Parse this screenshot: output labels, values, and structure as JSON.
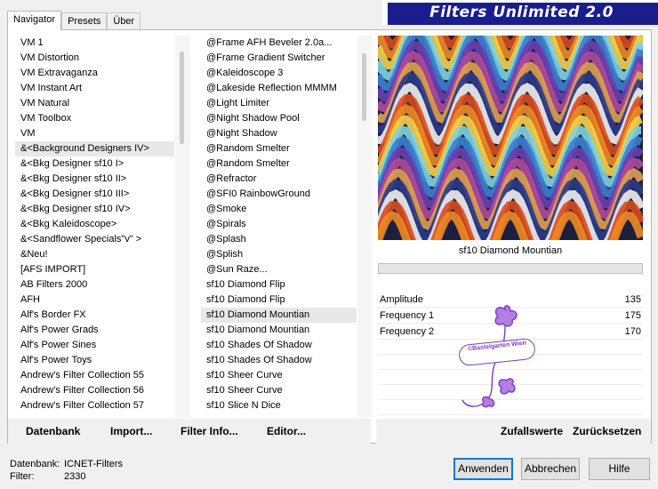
{
  "tabs": [
    "Navigator",
    "Presets",
    "Über"
  ],
  "app_title": "Filters Unlimited 2.0",
  "categories": [
    "VM 1",
    "VM Distortion",
    "VM Extravaganza",
    "VM Instant Art",
    "VM Natural",
    "VM Toolbox",
    "VM",
    "&<Background Designers IV>",
    "&<Bkg Designer sf10 I>",
    "&<Bkg Designer sf10 II>",
    "&<Bkg Designer sf10 III>",
    "&<Bkg Designer sf10 IV>",
    "&<Bkg Kaleidoscope>",
    "&<Sandflower Specials\"v\" >",
    "&Neu!",
    "[AFS IMPORT]",
    "AB Filters 2000",
    "AFH",
    "Alf's Border FX",
    "Alf's Power Grads",
    "Alf's Power Sines",
    "Alf's Power Toys",
    "Andrew's Filter Collection 55",
    "Andrew's Filter Collection 56",
    "Andrew's Filter Collection 57"
  ],
  "filters": [
    "@Frame AFH Beveler 2.0a...",
    "@Frame Gradient Switcher",
    "@Kaleidoscope 3",
    "@Lakeside Reflection MMMM",
    "@Light Limiter",
    "@Night Shadow Pool",
    "@Night Shadow",
    "@Random Smelter",
    "@Random Smelter",
    "@Refractor",
    "@SFI0 RainbowGround",
    "@Smoke",
    "@Spirals",
    "@Splash",
    "@Splish",
    "@Sun Raze...",
    "sf10 Diamond Flip",
    "sf10 Diamond Flip",
    "sf10 Diamond Mountian",
    "sf10 Diamond Mountian",
    "sf10 Shades Of Shadow",
    "sf10 Shades Of Shadow",
    "sf10 Sheer Curve",
    "sf10 Sheer Curve",
    "sf10 Slice N Dice"
  ],
  "selected_filter": "sf10 Diamond Mountian",
  "params": [
    {
      "label": "Amplitude",
      "value": "135"
    },
    {
      "label": "Frequency 1",
      "value": "175"
    },
    {
      "label": "Frequency 2",
      "value": "170"
    }
  ],
  "watermark": "©Bastelgarten Wien",
  "buttons": {
    "datenbank": "Datenbank",
    "import": "Import...",
    "filter_info": "Filter Info...",
    "editor": "Editor...",
    "zufallswerte": "Zufallswerte",
    "zuruecksetzen": "Zurücksetzen",
    "anwenden": "Anwenden",
    "abbrechen": "Abbrechen",
    "hilfe": "Hilfe"
  },
  "status": {
    "db_label": "Datenbank:",
    "db_value": "ICNET-Filters",
    "filter_label": "Filter:",
    "filter_value": "2330"
  },
  "colors": {
    "banner": "#1a1e8c",
    "default_button_border": "#0078d7",
    "watermark": "#7a3fc0"
  }
}
